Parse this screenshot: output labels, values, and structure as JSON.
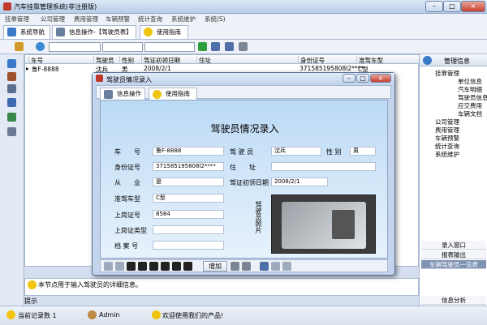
{
  "app": {
    "title": "汽车挂靠管理系统(非注册版)",
    "min": "–",
    "max": "□",
    "close": "×"
  },
  "menu": [
    "挂靠管理",
    "公司管理",
    "费用管理",
    "车辆预警",
    "统计查询",
    "系统维护",
    "系统(S)"
  ],
  "tabs": {
    "nav": "系统导航",
    "info": "信息操作-【驾驶员表】",
    "guide": "使用指南"
  },
  "grid": {
    "headers": [
      "车号",
      "驾驶员",
      "性别",
      "驾证初领日期",
      "住址",
      "身份证号",
      "准驾车型"
    ],
    "row": {
      "plate": "鲁F-8888",
      "driver": "沈兵",
      "gender": "男",
      "date": "2008/2/1",
      "address": "",
      "id": "371585195808l2****",
      "type": "C型"
    }
  },
  "right": {
    "header": "管理信息",
    "tree": [
      "挂靠管理",
      "单位信息",
      "汽车明细",
      "驾驶员信息",
      "应交费用",
      "车辆文档",
      "公司管理",
      "费用管理",
      "车辆预警",
      "统计查询",
      "系统维护"
    ],
    "buttons": [
      "录入窗口",
      "报表输出",
      "车辆驾驶员一览表",
      "信息分析"
    ]
  },
  "info": {
    "text": "本节点用于输入驾驶员的详细信息。",
    "label": "提示"
  },
  "status": {
    "records": "当前记录数 1",
    "user": "Admin",
    "welcome": "欢迎使用我们的产品!"
  },
  "dialog": {
    "title": "驾驶员情况录入",
    "tab_ops": "信息操作",
    "tab_guide": "使用指南",
    "heading": "驾驶员情况录入",
    "labels": {
      "plate": "车　　号",
      "driver": "驾 驶 员",
      "gender": "性 别",
      "id": "身份证号",
      "address": "住　　址",
      "work": "从　　业",
      "date": "驾证初领日期",
      "type": "准驾车型",
      "permit": "上岗证号",
      "permit_type": "上岗证类型",
      "file": "档 案 号",
      "photo": "驾驶员照片"
    },
    "values": {
      "plate": "鲁F-8888",
      "driver": "沈兵",
      "gender": "男",
      "id": "371585195808l2****",
      "address": "",
      "work": "是",
      "date": "2008/2/1",
      "type": "C型",
      "permit": "8584",
      "permit_type": "",
      "file": ""
    },
    "nav_add": "增加"
  }
}
